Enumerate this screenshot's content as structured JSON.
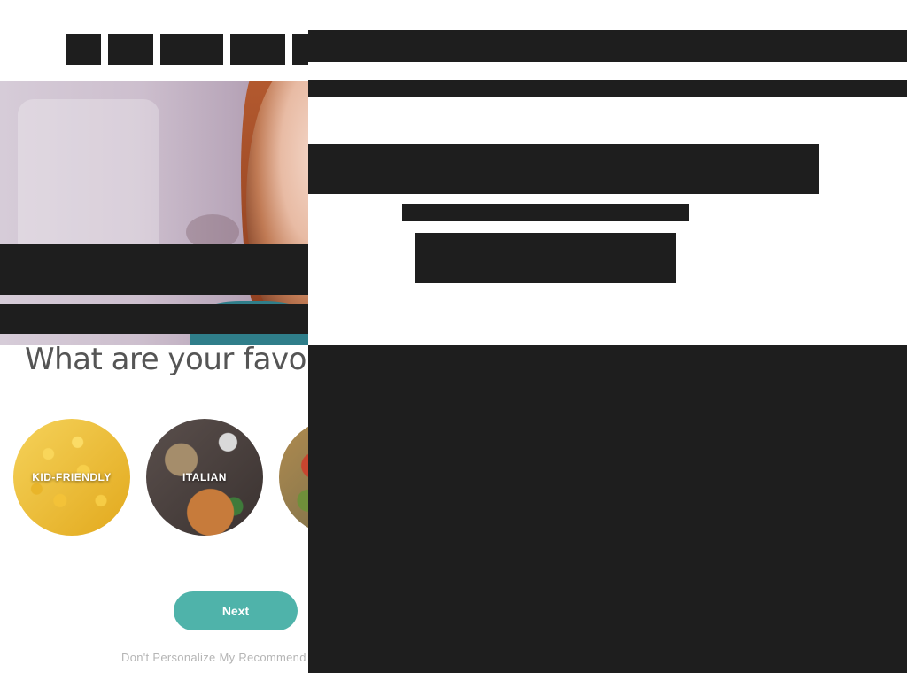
{
  "onboarding": {
    "question": "What are your favorite",
    "categories": [
      {
        "label": "KID-FRIENDLY"
      },
      {
        "label": "ITALIAN"
      },
      {
        "label": ""
      }
    ],
    "next_label": "Next",
    "skip_label": "Don't Personalize My Recommend"
  },
  "colors": {
    "accent": "#4fb3aa",
    "redaction": "#1e1e1e",
    "question_text": "#555555",
    "skip_text": "#b5b5b5"
  }
}
